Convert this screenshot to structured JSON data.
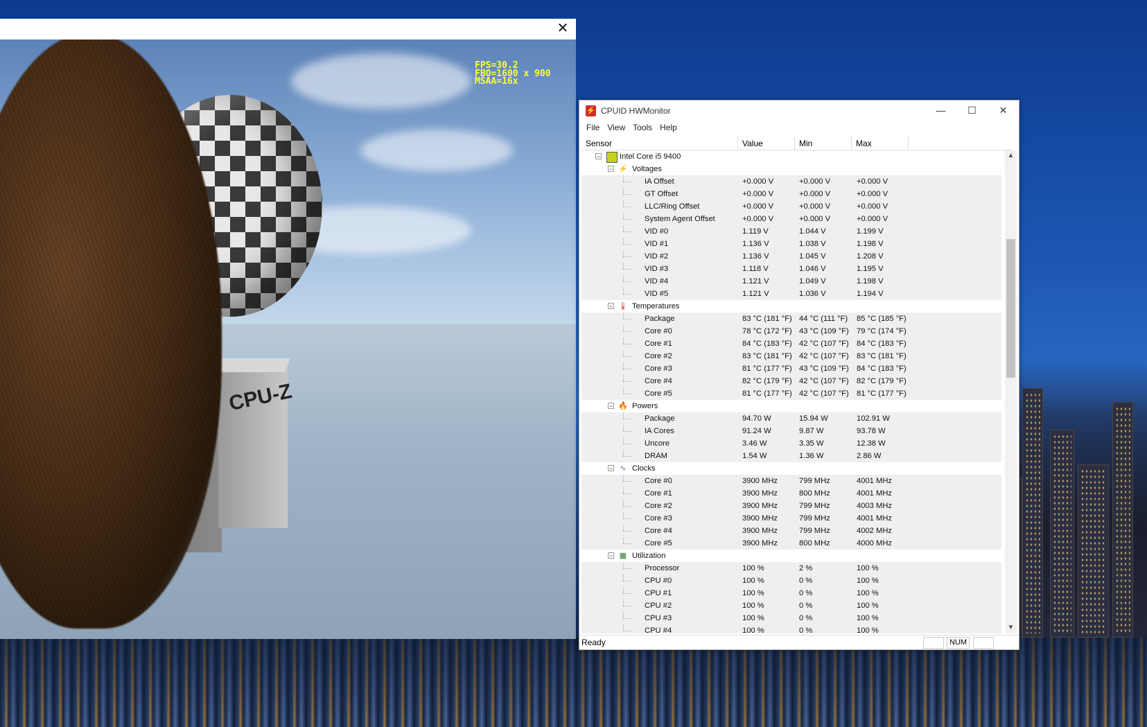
{
  "demo": {
    "fps": "FPS=30.2",
    "fbo": "FBO=1600 x 900",
    "msaa": "MSAA=16x",
    "close_icon": "close-icon",
    "logo": "CPU-Z"
  },
  "hwmonitor": {
    "app_title": "CPUID HWMonitor",
    "menu": [
      "File",
      "View",
      "Tools",
      "Help"
    ],
    "columns": [
      "Sensor",
      "Value",
      "Min",
      "Max"
    ],
    "device": "Intel Core i5 9400",
    "groups": [
      {
        "name": "Voltages",
        "icon": "voltage-icon",
        "rows": [
          [
            "IA Offset",
            "+0.000 V",
            "+0.000 V",
            "+0.000 V"
          ],
          [
            "GT Offset",
            "+0.000 V",
            "+0.000 V",
            "+0.000 V"
          ],
          [
            "LLC/Ring Offset",
            "+0.000 V",
            "+0.000 V",
            "+0.000 V"
          ],
          [
            "System Agent Offset",
            "+0.000 V",
            "+0.000 V",
            "+0.000 V"
          ],
          [
            "VID #0",
            "1.119 V",
            "1.044 V",
            "1.199 V"
          ],
          [
            "VID #1",
            "1.136 V",
            "1.038 V",
            "1.198 V"
          ],
          [
            "VID #2",
            "1.136 V",
            "1.045 V",
            "1.208 V"
          ],
          [
            "VID #3",
            "1.118 V",
            "1.046 V",
            "1.195 V"
          ],
          [
            "VID #4",
            "1.121 V",
            "1.049 V",
            "1.198 V"
          ],
          [
            "VID #5",
            "1.121 V",
            "1.036 V",
            "1.194 V"
          ]
        ]
      },
      {
        "name": "Temperatures",
        "icon": "thermometer-icon",
        "rows": [
          [
            "Package",
            "83 °C  (181 °F)",
            "44 °C  (111 °F)",
            "85 °C  (185 °F)"
          ],
          [
            "Core #0",
            "78 °C  (172 °F)",
            "43 °C  (109 °F)",
            "79 °C  (174 °F)"
          ],
          [
            "Core #1",
            "84 °C  (183 °F)",
            "42 °C  (107 °F)",
            "84 °C  (183 °F)"
          ],
          [
            "Core #2",
            "83 °C  (181 °F)",
            "42 °C  (107 °F)",
            "83 °C  (181 °F)"
          ],
          [
            "Core #3",
            "81 °C  (177 °F)",
            "43 °C  (109 °F)",
            "84 °C  (183 °F)"
          ],
          [
            "Core #4",
            "82 °C  (179 °F)",
            "42 °C  (107 °F)",
            "82 °C  (179 °F)"
          ],
          [
            "Core #5",
            "81 °C  (177 °F)",
            "42 °C  (107 °F)",
            "81 °C  (177 °F)"
          ]
        ]
      },
      {
        "name": "Powers",
        "icon": "flame-icon",
        "rows": [
          [
            "Package",
            "94.70 W",
            "15.94 W",
            "102.91 W"
          ],
          [
            "IA Cores",
            "91.24 W",
            "9.87 W",
            "93.78 W"
          ],
          [
            "Uncore",
            "3.46 W",
            "3.35 W",
            "12.38 W"
          ],
          [
            "DRAM",
            "1.54 W",
            "1.36 W",
            "2.86 W"
          ]
        ]
      },
      {
        "name": "Clocks",
        "icon": "clock-wave-icon",
        "rows": [
          [
            "Core #0",
            "3900 MHz",
            "799 MHz",
            "4001 MHz"
          ],
          [
            "Core #1",
            "3900 MHz",
            "800 MHz",
            "4001 MHz"
          ],
          [
            "Core #2",
            "3900 MHz",
            "799 MHz",
            "4003 MHz"
          ],
          [
            "Core #3",
            "3900 MHz",
            "799 MHz",
            "4001 MHz"
          ],
          [
            "Core #4",
            "3900 MHz",
            "799 MHz",
            "4002 MHz"
          ],
          [
            "Core #5",
            "3900 MHz",
            "800 MHz",
            "4000 MHz"
          ]
        ]
      },
      {
        "name": "Utilization",
        "icon": "utilization-icon",
        "rows": [
          [
            "Processor",
            "100 %",
            "2 %",
            "100 %"
          ],
          [
            "CPU #0",
            "100 %",
            "0 %",
            "100 %"
          ],
          [
            "CPU #1",
            "100 %",
            "0 %",
            "100 %"
          ],
          [
            "CPU #2",
            "100 %",
            "0 %",
            "100 %"
          ],
          [
            "CPU #3",
            "100 %",
            "0 %",
            "100 %"
          ],
          [
            "CPU #4",
            "100 %",
            "0 %",
            "100 %"
          ]
        ]
      }
    ],
    "status": "Ready",
    "num": "NUM"
  }
}
